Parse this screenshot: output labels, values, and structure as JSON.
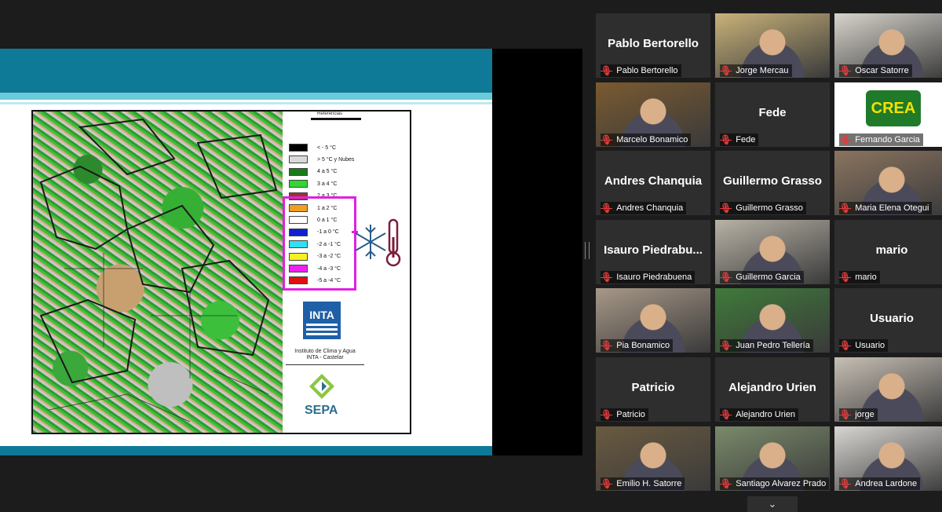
{
  "slide": {
    "legend_title": "Referencias",
    "legend": [
      {
        "label": "< - 5 °C",
        "color": "#000000"
      },
      {
        "label": "> 5 °C y Nubes",
        "color": "#d9d9d9"
      },
      {
        "label": "4 a 5 °C",
        "color": "#1a7a1a"
      },
      {
        "label": "3 a 4 °C",
        "color": "#33d633"
      },
      {
        "label": "2 a 3 °C",
        "color": "#a03030"
      },
      {
        "label": "1 a 2 °C",
        "color": "#f0a020"
      },
      {
        "label": "0 a 1 °C",
        "color": "#ffffff"
      },
      {
        "label": "-1 a 0 °C",
        "color": "#1020d0"
      },
      {
        "label": "-2 a -1 °C",
        "color": "#30e0f0"
      },
      {
        "label": "-3 a -2 °C",
        "color": "#f8f020"
      },
      {
        "label": "-4 a -3 °C",
        "color": "#f020f0"
      },
      {
        "label": "-5 a -4 °C",
        "color": "#e01010"
      }
    ],
    "inta_label": "INTA",
    "inta_caption_1": "Instituto de Clima y Agua",
    "inta_caption_2": "INTA - Castelar",
    "sepa_label": "SEPA"
  },
  "participants": [
    {
      "name": "Pablo Bertorello",
      "display": "Pablo Bertorello",
      "video": false
    },
    {
      "name": "Jorge Mercau",
      "display": "",
      "video": true,
      "tone": "#c9b27a"
    },
    {
      "name": "Oscar Satorre",
      "display": "",
      "video": true,
      "tone": "#d8d4cc"
    },
    {
      "name": "Marcelo Bonamico",
      "display": "",
      "video": true,
      "tone": "#7a5a30"
    },
    {
      "name": "Fede",
      "display": "Fede",
      "video": false
    },
    {
      "name": "Fernando Garcia",
      "display": "",
      "video": true,
      "tone": "#1f7a2a",
      "logo": "CREA"
    },
    {
      "name": "Andres Chanquia",
      "display": "Andres Chanquia",
      "video": false
    },
    {
      "name": "Guillermo Grasso",
      "display": "Guillermo Grasso",
      "video": false
    },
    {
      "name": "Maria Elena Otegui",
      "display": "",
      "video": true,
      "tone": "#8a7460",
      "active": true
    },
    {
      "name": "Isauro Piedrabuena",
      "display": "Isauro Piedrabu...",
      "video": false
    },
    {
      "name": "Guillermo Garcia",
      "display": "",
      "video": true,
      "tone": "#b8b2a6"
    },
    {
      "name": "mario",
      "display": "mario",
      "video": false
    },
    {
      "name": "Pia Bonamico",
      "display": "",
      "video": true,
      "tone": "#a89888"
    },
    {
      "name": "Juan Pedro Tellería",
      "display": "",
      "video": true,
      "tone": "#3f7a3a"
    },
    {
      "name": "Usuario",
      "display": "Usuario",
      "video": false
    },
    {
      "name": "Patricio",
      "display": "Patricio",
      "video": false
    },
    {
      "name": "Alejandro  Urien",
      "display": "Alejandro  Urien",
      "video": false
    },
    {
      "name": "jorge",
      "display": "",
      "video": true,
      "tone": "#c7bfb4"
    },
    {
      "name": "Emilio H. Satorre",
      "display": "",
      "video": true,
      "tone": "#6a5a40"
    },
    {
      "name": "Santiago Alvarez Prado",
      "display": "",
      "video": true,
      "tone": "#7a8a6a"
    },
    {
      "name": "Andrea Lardone",
      "display": "",
      "video": true,
      "tone": "#d8d6d2"
    }
  ],
  "ui": {
    "scroll_down_icon": "chevron-down-icon",
    "scroll_glyph": "⌄",
    "mic_glyph": "🎙"
  }
}
